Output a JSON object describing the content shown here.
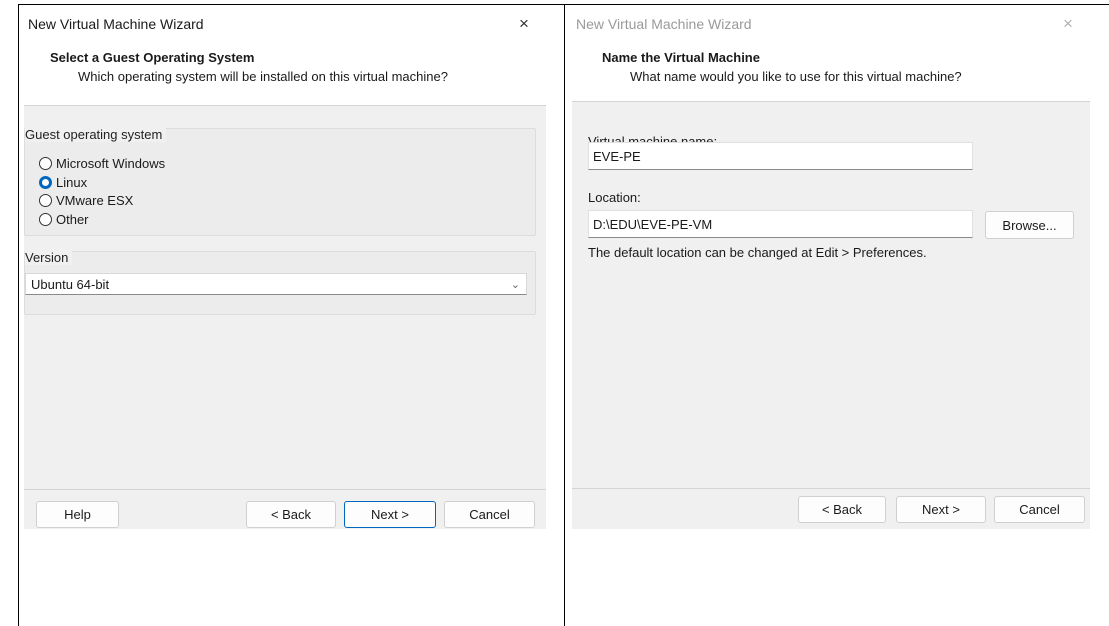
{
  "left_dialog": {
    "title": "New Virtual Machine Wizard",
    "close_glyph": "×",
    "heading": "Select a Guest Operating System",
    "subheading": "Which operating system will be installed on this virtual machine?",
    "guest_os_group_label": "Guest operating system",
    "guest_os_options": [
      {
        "label": "Microsoft Windows",
        "checked": false
      },
      {
        "label": "Linux",
        "checked": true
      },
      {
        "label": "VMware ESX",
        "checked": false
      },
      {
        "label": "Other",
        "checked": false
      }
    ],
    "version_group_label": "Version",
    "version_value": "Ubuntu 64-bit",
    "buttons": {
      "help": "Help",
      "back": "< Back",
      "next": "Next >",
      "cancel": "Cancel"
    }
  },
  "right_dialog": {
    "title": "New Virtual Machine Wizard",
    "close_glyph": "×",
    "heading": "Name the Virtual Machine",
    "subheading": "What name would you like to use for this virtual machine?",
    "vm_name_label": "Virtual machine name:",
    "vm_name_value": "EVE-PE",
    "location_label": "Location:",
    "location_value": "D:\\EDU\\EVE-PE-VM",
    "browse_label": "Browse...",
    "note": "The default location can be changed at Edit > Preferences.",
    "buttons": {
      "back": "< Back",
      "next": "Next >",
      "cancel": "Cancel"
    }
  },
  "colors": {
    "accent": "#0067c0",
    "dialog_bg": "#f0f0f0",
    "header_bg": "#ffffff"
  }
}
